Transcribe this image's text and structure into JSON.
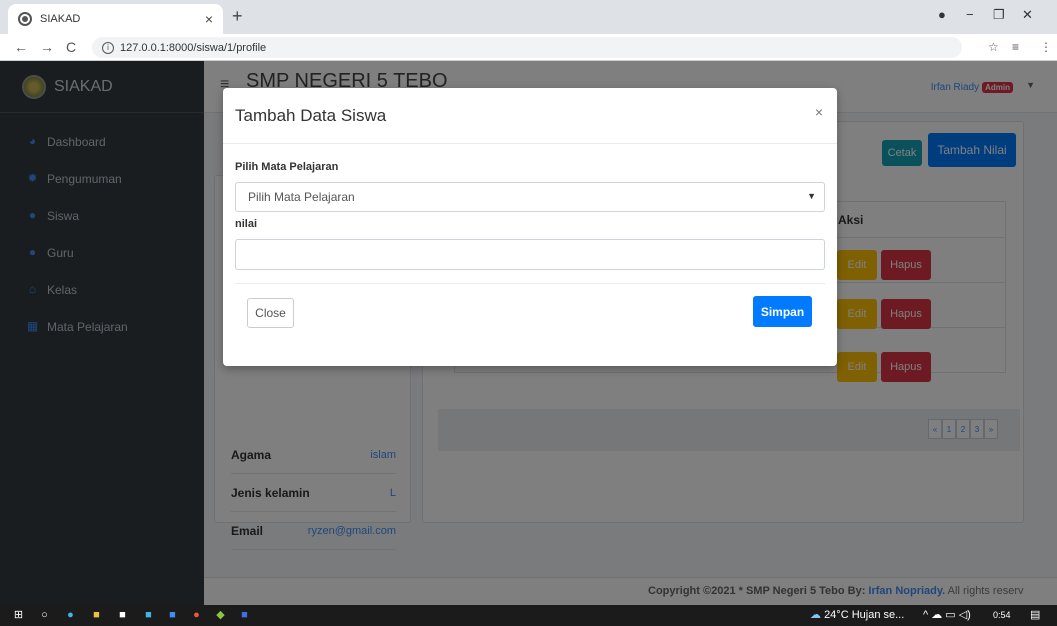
{
  "browser": {
    "tab_title": "SIAKAD",
    "tab_close": "×",
    "new_tab": "+",
    "url": "127.0.0.1:8000/siswa/1/profile",
    "back": "←",
    "forward": "→",
    "reload": "C",
    "star": "☆",
    "reading_list": "≡",
    "menu": "⋮",
    "minimize": "−",
    "maximize": "❐",
    "close": "✕"
  },
  "sidebar": {
    "brand": "SIAKAD",
    "items": [
      {
        "label": "Dashboard",
        "icon": "dashboard-icon"
      },
      {
        "label": "Pengumuman",
        "icon": "gear-icon"
      },
      {
        "label": "Siswa",
        "icon": "user-icon"
      },
      {
        "label": "Guru",
        "icon": "users-icon"
      },
      {
        "label": "Kelas",
        "icon": "home-icon"
      },
      {
        "label": "Mata Pelajaran",
        "icon": "table-icon"
      }
    ]
  },
  "topbar": {
    "school": "SMP NEGERI 5 TEBO",
    "user": "Irfan Riady",
    "role_badge": "Admin"
  },
  "profile": {
    "rows": [
      {
        "key": "Agama",
        "value": "islam"
      },
      {
        "key": "Jenis kelamin",
        "value": "L"
      },
      {
        "key": "Email",
        "value": "ryzen@gmail.com"
      }
    ]
  },
  "main": {
    "cetak": "Cetak",
    "tambah_nilai": "Tambah Nilai",
    "col_aksi": "Aksi",
    "edit": "Edit",
    "hapus": "Hapus",
    "pager": [
      "«",
      "1",
      "2",
      "3",
      "»"
    ]
  },
  "footer": {
    "prefix": "Copyright ©2021 * SMP Negeri 5 Tebo By: ",
    "author": "Irfan Nopriady.",
    "suffix": " All rights reserv"
  },
  "modal": {
    "title": "Tambah Data Siswa",
    "close_x": "×",
    "label_mapel": "Pilih Mata Pelajaran",
    "select_value": "Pilih Mata Pelajaran",
    "label_nilai": "nilai",
    "nilai_value": "",
    "close_button": "Close",
    "save_button": "Simpan"
  },
  "taskbar": {
    "weather": "24°C  Hujan se...",
    "time": "0:54"
  },
  "colors": {
    "primary": "#007bff",
    "info": "#17a2b8",
    "warning": "#ffc107",
    "danger": "#dc3545",
    "sidebar": "#343a40"
  }
}
